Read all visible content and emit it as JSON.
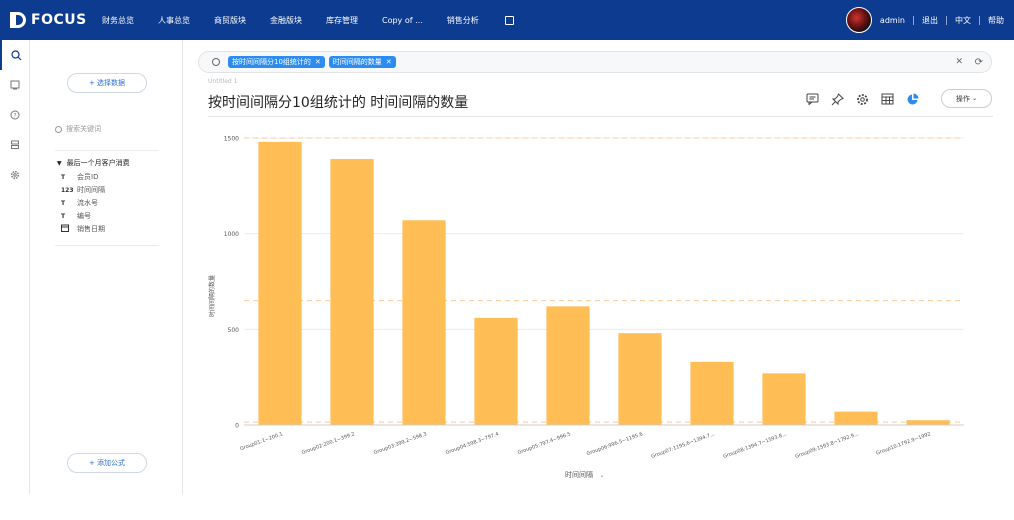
{
  "topbar": {
    "logo_text": "FOCUS",
    "nav": [
      "财务总览",
      "人事总览",
      "商贸版块",
      "金融版块",
      "库存管理",
      "Copy of ...",
      "销售分析"
    ],
    "user": "admin",
    "logout": "退出",
    "lang": "中文",
    "help": "帮助"
  },
  "left": {
    "choose_data": "+ 选择数据",
    "keyword_placeholder": "搜索关键词",
    "table_name": "最后一个月客户消费",
    "fields": [
      {
        "type": "T",
        "name": "会员ID"
      },
      {
        "type": "123",
        "name": "时间间隔"
      },
      {
        "type": "T",
        "name": "流水号"
      },
      {
        "type": "T",
        "name": "编号"
      },
      {
        "type": "date",
        "name": "销售日期"
      }
    ],
    "add_formula": "+ 添加公式"
  },
  "search": {
    "chips": [
      "按时间间隔分10组统计的",
      "时间间隔的数量"
    ]
  },
  "crumb": "Untitled 1",
  "title": "按时间间隔分10组统计的 时间间隔的数量",
  "toolbar": {
    "operate": "操作"
  },
  "chart_data": {
    "type": "bar",
    "color": "#ffbd55",
    "ylabel": "时间间隔的数量",
    "xlabel": "时间间隔",
    "ylim": [
      0,
      1500
    ],
    "yticks": [
      0,
      500,
      1000,
      1500
    ],
    "categories": [
      "Group01:1~200.1",
      "Group02:200.1~399.2",
      "Group03:399.2~598.3",
      "Group04:598.3~797.4",
      "Group05:797.4~996.5",
      "Group06:996.5~1195.6",
      "Group07:1195.6~1394.7...",
      "Group08:1394.7~1593.8...",
      "Group09:1593.8~1792.9...",
      "Group10:1792.9~1992"
    ],
    "values": [
      1480,
      1390,
      1070,
      560,
      620,
      480,
      330,
      270,
      70,
      25
    ]
  }
}
